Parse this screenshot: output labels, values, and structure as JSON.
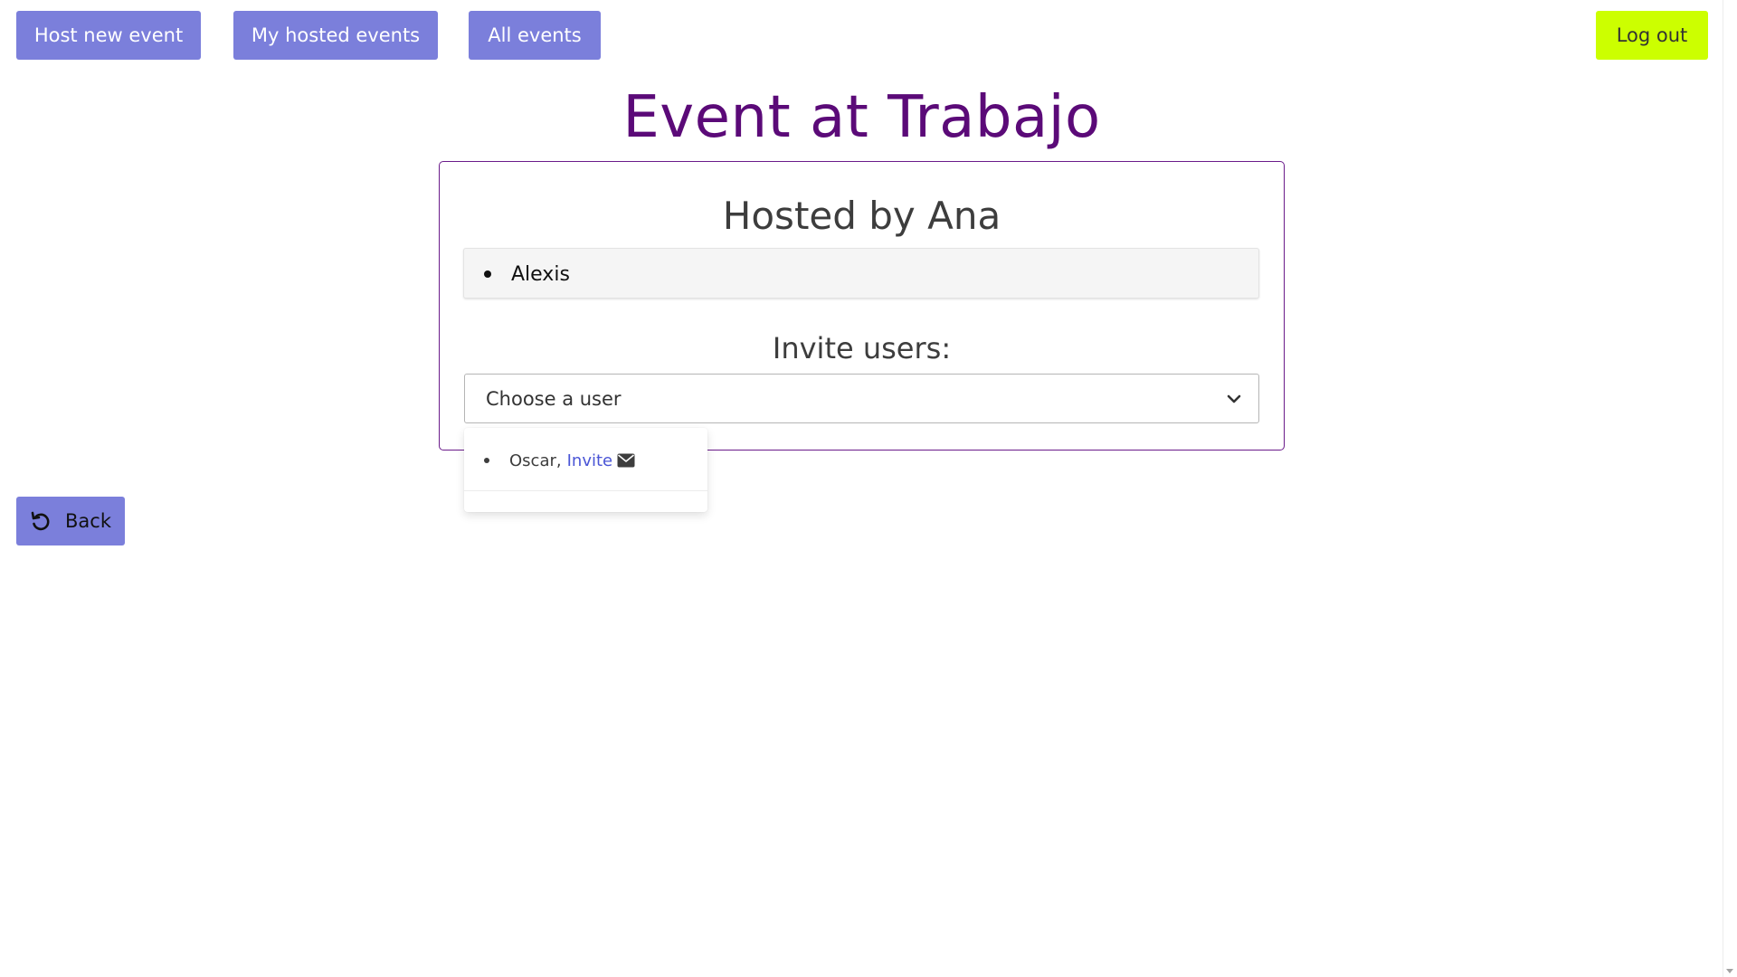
{
  "nav": {
    "host_new_event": "Host new event",
    "my_hosted_events": "My hosted events",
    "all_events": "All events",
    "log_out": "Log out"
  },
  "page": {
    "title": "Event at Trabajo"
  },
  "card": {
    "hosted_by": "Hosted by Ana",
    "attendees": [
      "Alexis"
    ],
    "invite_label": "Invite users:",
    "select_value": "Choose a user"
  },
  "dropdown": {
    "items": [
      {
        "name": "Oscar,",
        "action": "Invite",
        "icon": "envelope-icon"
      }
    ]
  },
  "back": {
    "label": "Back",
    "icon": "undo-icon"
  },
  "colors": {
    "nav_button": "#7b7fdb",
    "logout_button": "#ccff00",
    "title": "#5b0a78",
    "card_border": "#6a1b8a",
    "link": "#4a55d6"
  }
}
